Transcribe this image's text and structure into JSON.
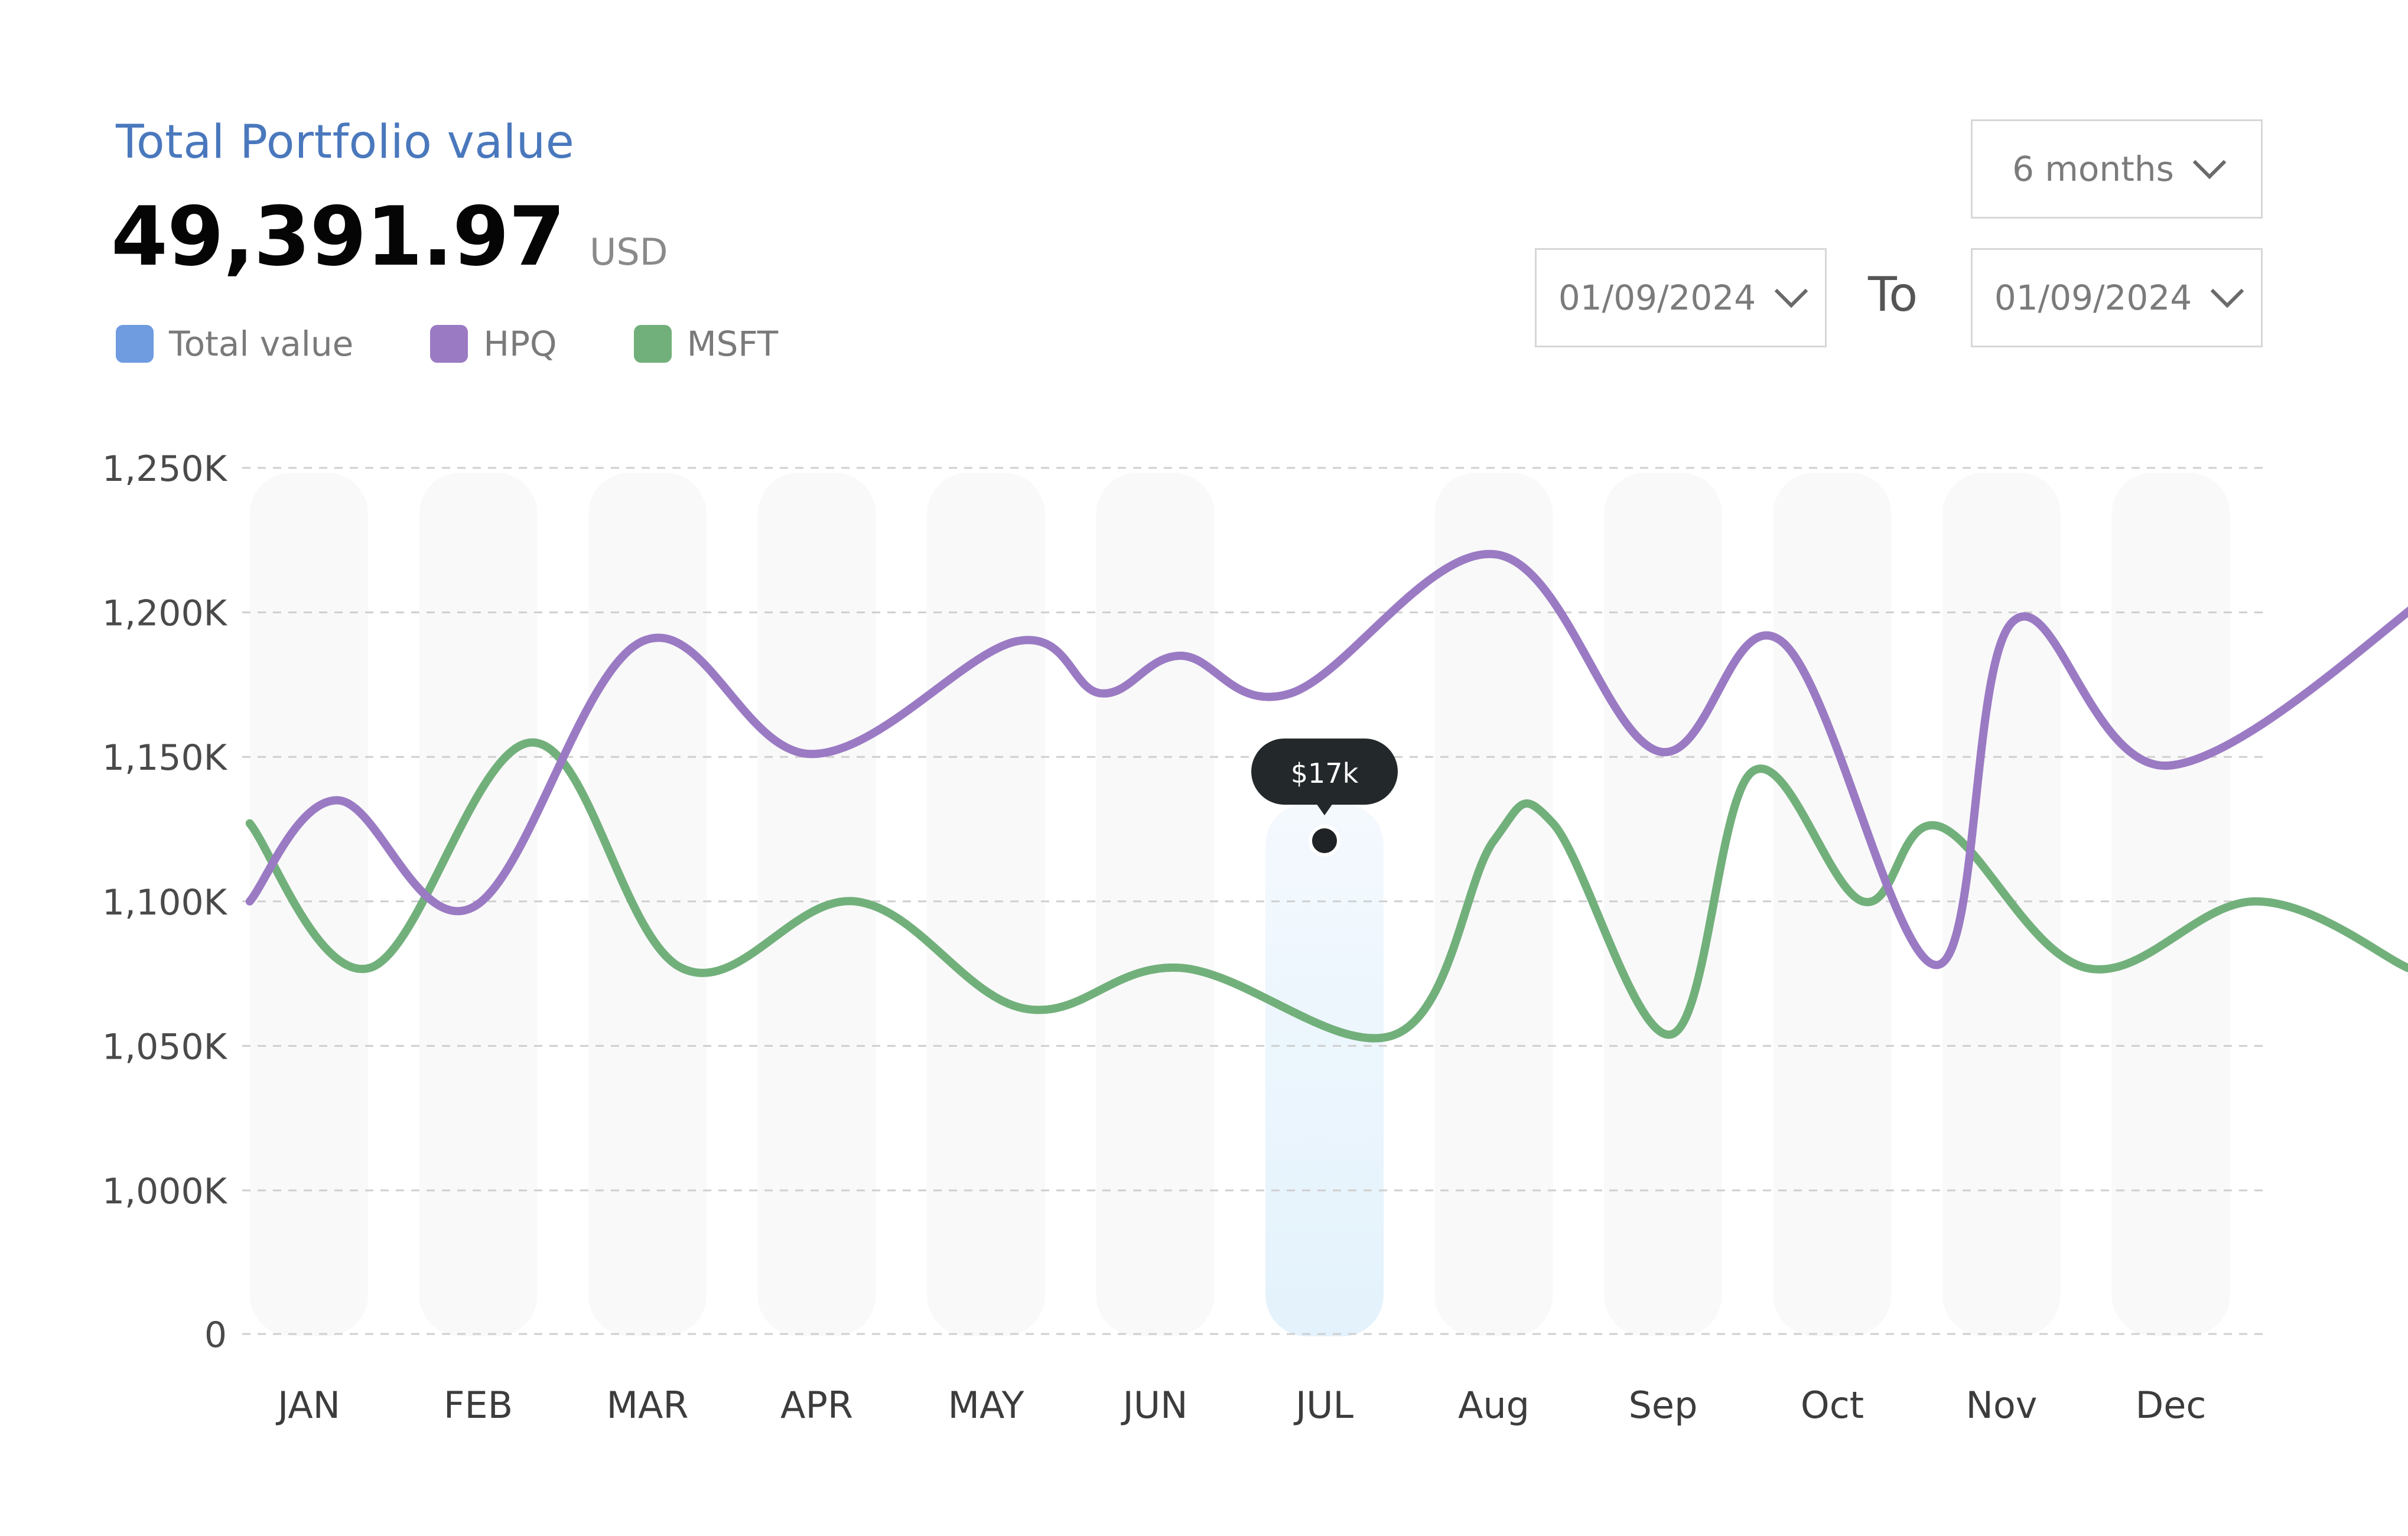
{
  "header": {
    "title": "Total Portfolio value",
    "total_value": "49,391.97",
    "currency": "USD"
  },
  "legend": [
    {
      "label": "Total value",
      "color": "#6f9be0"
    },
    {
      "label": "HPQ",
      "color": "#9b7ac4"
    },
    {
      "label": "MSFT",
      "color": "#72b07b"
    }
  ],
  "controls": {
    "range_select": "6 months",
    "date_from": "01/09/2024",
    "to_label": "To",
    "date_to": "01/09/2024"
  },
  "chart_data": {
    "type": "line",
    "categories": [
      "JAN",
      "FEB",
      "MAR",
      "APR",
      "MAY",
      "JUN",
      "JUL",
      "Aug",
      "Sep",
      "Oct",
      "Nov",
      "Dec"
    ],
    "y_ticks": [
      "0",
      "1,000K",
      "1,050K",
      "1,100K",
      "1,150K",
      "1,200K",
      "1,250K"
    ],
    "x": [
      -0.35,
      0.17,
      0.97,
      1.72,
      2.2,
      3.05,
      3.9,
      4.18,
      4.5,
      5.2,
      5.7,
      6.3,
      7.23,
      7.97,
      8.7,
      9.57,
      10.04,
      10.45,
      10.85,
      11.38,
      12.3
    ],
    "series": [
      {
        "name": "HPQ",
        "color": "#9b7ac4",
        "values": [
          1100,
          1135,
          1098,
          1190,
          1150,
          1190,
          1172,
          1185,
          1172,
          1220,
          1152,
          1190,
          1078,
          1197,
          1147,
          1209,
          null,
          null,
          null,
          null,
          null
        ]
      },
      {
        "name": "MSFT",
        "color": "#72b07b",
        "values": [
          1127,
          1077,
          1155,
          1077,
          1100,
          1063,
          1077,
          1054,
          1120,
          1127,
          1054,
          1145,
          1100,
          1126,
          1077,
          1100,
          1063,
          1077,
          null,
          null,
          null
        ]
      }
    ],
    "hpq_x": [
      -0.35,
      0.17,
      0.97,
      1.97,
      2.97,
      4.18,
      4.68,
      5.15,
      5.8,
      7.02,
      7.97,
      8.7,
      9.62,
      10.07,
      10.99,
      12.6
    ],
    "msft_x": [
      -0.35,
      0.36,
      1.32,
      2.2,
      3.23,
      4.22,
      5.15,
      6.42,
      7.0,
      7.35,
      8.05,
      8.53,
      9.18,
      9.63,
      10.5,
      11.5,
      12.4
    ],
    "hpq_values": [
      1100,
      1135,
      1098,
      1190,
      1151,
      1190,
      1172,
      1185,
      1172,
      1220,
      1152,
      1190,
      1078,
      1197,
      1147,
      1209
    ],
    "msft_values": [
      1127,
      1077,
      1155,
      1077,
      1100,
      1063,
      1077,
      1054,
      1121,
      1127,
      1054,
      1145,
      1100,
      1126,
      1077,
      1100,
      1077
    ],
    "highlight": {
      "category": "JUL",
      "tooltip": "$17k",
      "value": 1121
    },
    "ylim": [
      0,
      1250
    ],
    "grid": true,
    "legend_position": "top-left"
  }
}
